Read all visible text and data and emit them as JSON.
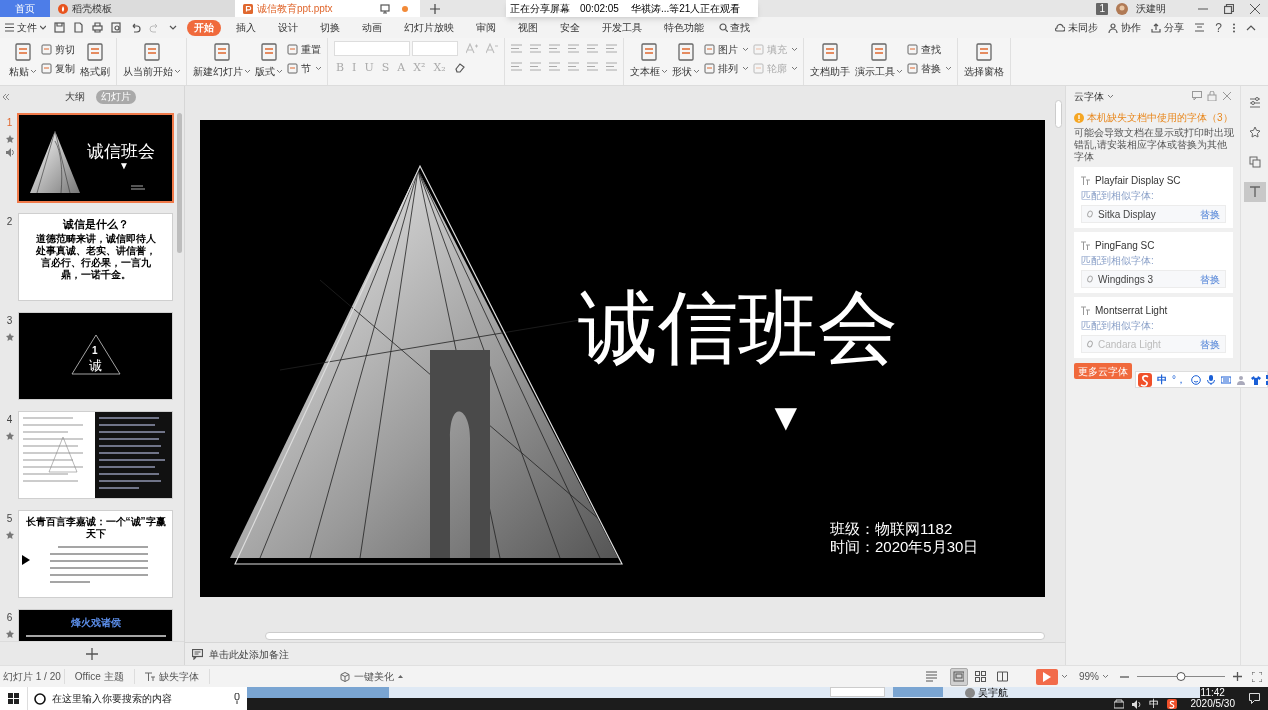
{
  "tabs": [
    {
      "label": "首页",
      "selected": false,
      "kind": "home",
      "modified": false
    },
    {
      "label": "稻壳模板",
      "selected": false,
      "kind": "docer",
      "modified": false
    },
    {
      "label": "诚信教育ppt.pptx",
      "selected": true,
      "kind": "file",
      "modified": true
    }
  ],
  "share_banner": {
    "status": "正在分享屏幕",
    "timer": "00:02:05",
    "viewers": "华祺涛...等21人正在观看"
  },
  "account": {
    "badge": "1",
    "user": "沃建明"
  },
  "menu": {
    "file": "文件",
    "search": "查找",
    "actions": [
      "未同步",
      "协作",
      "分享"
    ],
    "help": "?",
    "tabs": [
      {
        "label": "开始",
        "selected": true
      },
      {
        "label": "插入",
        "selected": false
      },
      {
        "label": "设计",
        "selected": false
      },
      {
        "label": "切换",
        "selected": false
      },
      {
        "label": "动画",
        "selected": false
      },
      {
        "label": "幻灯片放映",
        "selected": false
      },
      {
        "label": "审阅",
        "selected": false
      },
      {
        "label": "视图",
        "selected": false
      },
      {
        "label": "安全",
        "selected": false
      },
      {
        "label": "开发工具",
        "selected": false
      },
      {
        "label": "特色功能",
        "selected": false
      }
    ]
  },
  "ribbon": {
    "groups": [
      {
        "kind": "tools",
        "items": [
          {
            "label": "粘贴",
            "kind": "large",
            "dropdown": true,
            "disabled": false
          },
          {
            "label": "剪切",
            "kind": "small",
            "dropdown": false,
            "disabled": false
          },
          {
            "label": "复制",
            "kind": "small",
            "dropdown": false,
            "disabled": false
          },
          {
            "label": "格式刷",
            "kind": "large",
            "dropdown": false,
            "disabled": false
          }
        ]
      },
      {
        "kind": "tools",
        "items": [
          {
            "label": "从当前开始",
            "kind": "large",
            "dropdown": true,
            "disabled": false
          }
        ]
      },
      {
        "kind": "tools",
        "items": [
          {
            "label": "新建幻灯片",
            "kind": "large",
            "dropdown": true,
            "disabled": false
          },
          {
            "label": "版式",
            "kind": "large",
            "dropdown": true,
            "disabled": false
          },
          {
            "label": "重置",
            "kind": "small",
            "dropdown": false,
            "disabled": false
          },
          {
            "label": "节",
            "kind": "small",
            "dropdown": true,
            "disabled": false
          }
        ]
      },
      {
        "kind": "font",
        "glyphs": [
          "B",
          "I",
          "U",
          "S",
          "A",
          "X²",
          "X₂"
        ]
      },
      {
        "kind": "paragraph"
      },
      {
        "kind": "tools",
        "items": [
          {
            "label": "文本框",
            "kind": "large",
            "dropdown": true,
            "disabled": false
          },
          {
            "label": "形状",
            "kind": "large",
            "dropdown": true,
            "disabled": false
          },
          {
            "label": "图片",
            "kind": "small",
            "dropdown": true,
            "disabled": false
          },
          {
            "label": "排列",
            "kind": "small",
            "dropdown": true,
            "disabled": false
          },
          {
            "label": "填充",
            "kind": "small",
            "dropdown": true,
            "disabled": true
          },
          {
            "label": "轮廓",
            "kind": "small",
            "dropdown": true,
            "disabled": true
          }
        ]
      },
      {
        "kind": "tools",
        "items": [
          {
            "label": "文档助手",
            "kind": "large",
            "dropdown": false,
            "disabled": false
          },
          {
            "label": "演示工具",
            "kind": "large",
            "dropdown": true,
            "disabled": false
          },
          {
            "label": "查找",
            "kind": "small",
            "dropdown": false,
            "disabled": false
          },
          {
            "label": "替换",
            "kind": "small",
            "dropdown": true,
            "disabled": false
          }
        ]
      },
      {
        "kind": "tools",
        "items": [
          {
            "label": "选择窗格",
            "kind": "large",
            "dropdown": false,
            "disabled": false
          }
        ]
      }
    ]
  },
  "panel_tabs": [
    {
      "label": "大纲",
      "selected": false
    },
    {
      "label": "幻灯片",
      "selected": true
    }
  ],
  "slides": [
    {
      "number": "1",
      "selected": true,
      "kind": "title",
      "animation": true,
      "audio": true,
      "title": "诚信班会",
      "marker": "▼"
    },
    {
      "number": "2",
      "selected": false,
      "kind": "text",
      "animation": false,
      "audio": false,
      "title": "诚信是什么？",
      "body": "道德范畴来讲，诚信即待人处事真诚、老实、讲信誉，言必行、行必果，一言九鼎，一诺千金。"
    },
    {
      "number": "3",
      "selected": false,
      "kind": "section",
      "animation": true,
      "audio": false,
      "title": "诚",
      "index": "1"
    },
    {
      "number": "4",
      "selected": false,
      "kind": "quotes",
      "animation": true,
      "audio": false
    },
    {
      "number": "5",
      "selected": false,
      "kind": "article",
      "animation": true,
      "audio": false,
      "title": "长青百言李嘉诚：一个“诚”字赢天下"
    },
    {
      "number": "6",
      "selected": false,
      "kind": "banner",
      "animation": true,
      "audio": false,
      "title": "烽火戏诸侯"
    }
  ],
  "slide": {
    "title": "诚信班会",
    "marker": "▼",
    "details": [
      "班级：物联网1182",
      "时间：2020年5月30日"
    ]
  },
  "notes": {
    "placeholder": "单击此处添加备注"
  },
  "cloud_fonts": {
    "title": "云字体",
    "warning": "本机缺失文档中使用的字体（3）",
    "description": "可能会导致文档在显示或打印时出现错乱,请安装相应字体或替换为其他字体",
    "more_button": "更多云字体",
    "fonts": [
      {
        "name": "Playfair Display SC",
        "match_label": "匹配到相似字体:",
        "match": "Sitka Display",
        "action": "替换",
        "disabled": false
      },
      {
        "name": "PingFang SC",
        "match_label": "匹配到相似字体:",
        "match": "Wingdings 3",
        "action": "替换",
        "disabled": false
      },
      {
        "name": "Montserrat Light",
        "match_label": "匹配到相似字体:",
        "match": "Candara Light",
        "action": "替换",
        "disabled": true
      }
    ]
  },
  "side_tools": [
    {
      "selected": false
    },
    {
      "selected": false
    },
    {
      "selected": false
    },
    {
      "selected": true
    }
  ],
  "ime_toolbar": {
    "mode": "中",
    "punctuation": "°，"
  },
  "status_bar": {
    "slide_counter": "幻灯片 1 / 20",
    "theme": "Office 主题",
    "missing_fonts": "缺失字体",
    "beautify": "一键美化",
    "zoom": "99%",
    "zoom_slider": {
      "level": 0.5
    },
    "views": [
      {
        "selected": true
      },
      {
        "selected": false
      },
      {
        "selected": false
      }
    ]
  },
  "taskbar": {
    "search_placeholder": "在这里输入你要搜索的内容",
    "popup_user": "吴宇航",
    "ime": "中",
    "time": "11:42",
    "date": "2020/5/30"
  }
}
